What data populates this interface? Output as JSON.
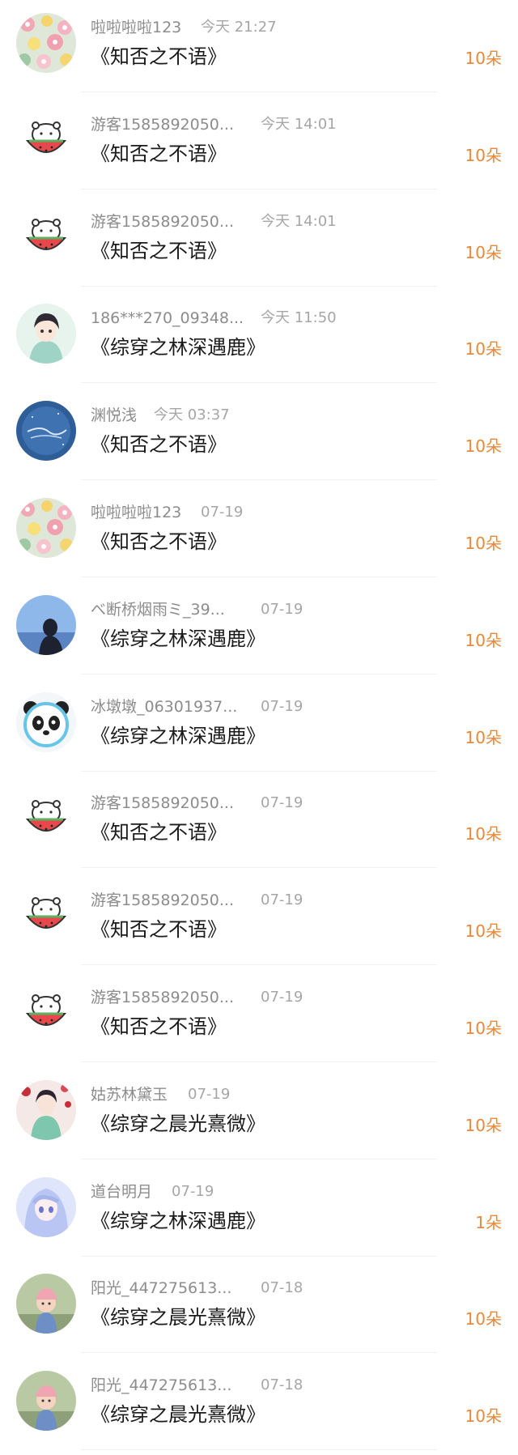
{
  "colors": {
    "amount": "#e8883a",
    "name": "#8c8c8c",
    "time": "#a6a6a6",
    "title": "#1a1a1a",
    "divider": "#f0f0f0"
  },
  "records": [
    {
      "name": "啦啦啦啦123",
      "time": "今天 21:27",
      "book": "《知否之不语》",
      "amount": "10朵",
      "avatar": "flower-pattern"
    },
    {
      "name": "游客1585892050...",
      "time": "今天 14:01",
      "book": "《知否之不语》",
      "amount": "10朵",
      "avatar": "watermelon-bear"
    },
    {
      "name": "游客1585892050...",
      "time": "今天 14:01",
      "book": "《知否之不语》",
      "amount": "10朵",
      "avatar": "watermelon-bear"
    },
    {
      "name": "186***270_09348...",
      "time": "今天 11:50",
      "book": "《综穿之林深遇鹿》",
      "amount": "10朵",
      "avatar": "anime-boy"
    },
    {
      "name": "渊悦浅",
      "time": "今天 03:37",
      "book": "《知否之不语》",
      "amount": "10朵",
      "avatar": "blue-calligraphy"
    },
    {
      "name": "啦啦啦啦123",
      "time": "07-19",
      "book": "《知否之不语》",
      "amount": "10朵",
      "avatar": "flower-pattern"
    },
    {
      "name": "べ断桥烟雨ミ_39...",
      "time": "07-19",
      "book": "《综穿之林深遇鹿》",
      "amount": "10朵",
      "avatar": "sky-silhouette"
    },
    {
      "name": "冰墩墩_06301937...",
      "time": "07-19",
      "book": "《综穿之林深遇鹿》",
      "amount": "10朵",
      "avatar": "panda"
    },
    {
      "name": "游客1585892050...",
      "time": "07-19",
      "book": "《知否之不语》",
      "amount": "10朵",
      "avatar": "watermelon-bear"
    },
    {
      "name": "游客1585892050...",
      "time": "07-19",
      "book": "《知否之不语》",
      "amount": "10朵",
      "avatar": "watermelon-bear"
    },
    {
      "name": "游客1585892050...",
      "time": "07-19",
      "book": "《知否之不语》",
      "amount": "10朵",
      "avatar": "watermelon-bear"
    },
    {
      "name": "姑苏林黛玉",
      "time": "07-19",
      "book": "《综穿之晨光熹微》",
      "amount": "10朵",
      "avatar": "ancient-lady"
    },
    {
      "name": "道台明月",
      "time": "07-19",
      "book": "《综穿之林深遇鹿》",
      "amount": "1朵",
      "avatar": "anime-girl-blue"
    },
    {
      "name": "阳光_447275613...",
      "time": "07-18",
      "book": "《综穿之晨光熹微》",
      "amount": "10朵",
      "avatar": "baby-photo"
    },
    {
      "name": "阳光_447275613...",
      "time": "07-18",
      "book": "《综穿之晨光熹微》",
      "amount": "10朵",
      "avatar": "baby-photo"
    }
  ]
}
